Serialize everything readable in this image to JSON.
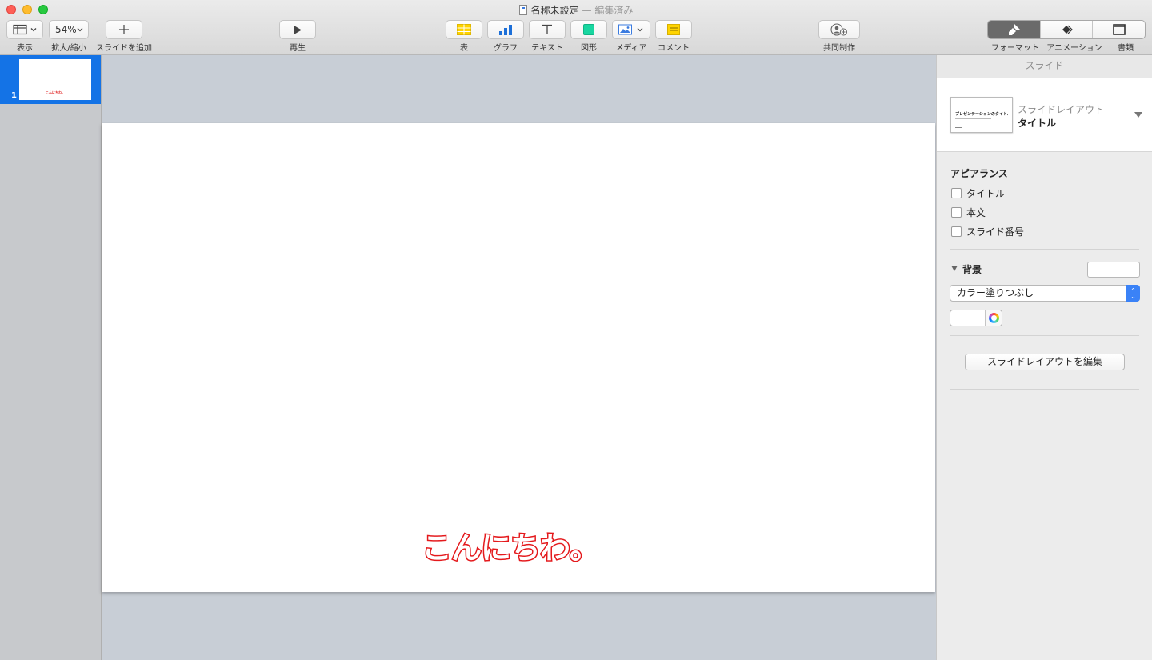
{
  "window": {
    "title": "名称未設定",
    "edited_suffix": "— 編集済み"
  },
  "toolbar": {
    "view_label": "表示",
    "zoom_value": "54%",
    "zoom_label": "拡大/縮小",
    "add_slide_label": "スライドを追加",
    "play_label": "再生",
    "table_label": "表",
    "chart_label": "グラフ",
    "text_label": "テキスト",
    "shape_label": "図形",
    "media_label": "メディア",
    "comment_label": "コメント",
    "collab_label": "共同制作",
    "format_label": "フォーマット",
    "animate_label": "アニメーション",
    "document_label": "書類",
    "icons": {
      "view": "sidebar-layout-icon",
      "add": "plus-icon",
      "play": "play-icon",
      "table": "table-icon",
      "chart": "bar-chart-icon",
      "text": "text-icon",
      "shape": "shape-icon",
      "media": "image-icon",
      "comment": "comment-icon",
      "collab": "add-person-icon",
      "format": "paintbrush-icon",
      "animate": "diamond-animation-icon",
      "document": "document-icon"
    }
  },
  "navigator": {
    "slides": [
      {
        "number": "1",
        "thumb_text": "こんにちわ。"
      }
    ]
  },
  "slide": {
    "text": "こんにちわ。",
    "text_color": "#e4191c"
  },
  "inspector": {
    "header": "スライド",
    "layout_caption": "スライドレイアウト",
    "layout_name": "タイトル",
    "layout_thumb_title": "プレゼンテーションのタイトル",
    "appearance_title": "アピアランス",
    "checkboxes": [
      {
        "label": "タイトル",
        "checked": false
      },
      {
        "label": "本文",
        "checked": false
      },
      {
        "label": "スライド番号",
        "checked": false
      }
    ],
    "background_title": "背景",
    "fill_option": "カラー塗りつぶし",
    "edit_layout_button": "スライドレイアウトを編集"
  },
  "colors": {
    "selection": "#1473e6",
    "canvas_bg": "#c8ced6",
    "accent": "#3a82f7"
  }
}
